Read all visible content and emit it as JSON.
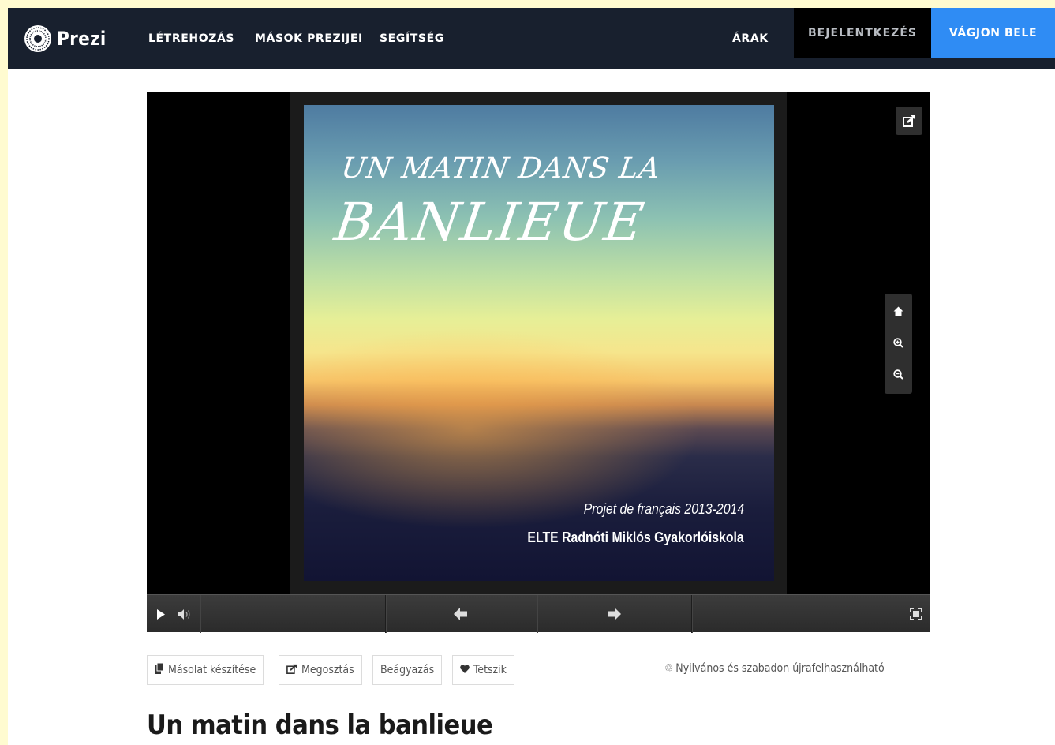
{
  "nav": {
    "logo_text": "Prezi",
    "links": [
      "LÉTREHOZÁS",
      "MÁSOK PREZIJEI",
      "SEGÍTSÉG"
    ],
    "pricing": "ÁRAK",
    "login": "BEJELENTKEZÉS",
    "signup": "VÁGJON BELE"
  },
  "slide": {
    "title_line1": "UN MATIN DANS LA",
    "title_line2": "BANLIEUE",
    "subtitle1": "Projet de français 2013-2014",
    "subtitle2": "ELTE Radnóti Miklós Gyakorlóiskola"
  },
  "actions": {
    "copy": "Másolat készítése",
    "share": "Megosztás",
    "embed": "Beágyazás",
    "like": "Tetszik"
  },
  "license": "Nyilvános és szabadon újrafelhasználható",
  "page_title": "Un matin dans la banlieue",
  "colors": {
    "nav_bg": "#18202e",
    "signup_bg": "#2f8cf4",
    "login_bg": "#000000",
    "player_bg": "#000000"
  }
}
